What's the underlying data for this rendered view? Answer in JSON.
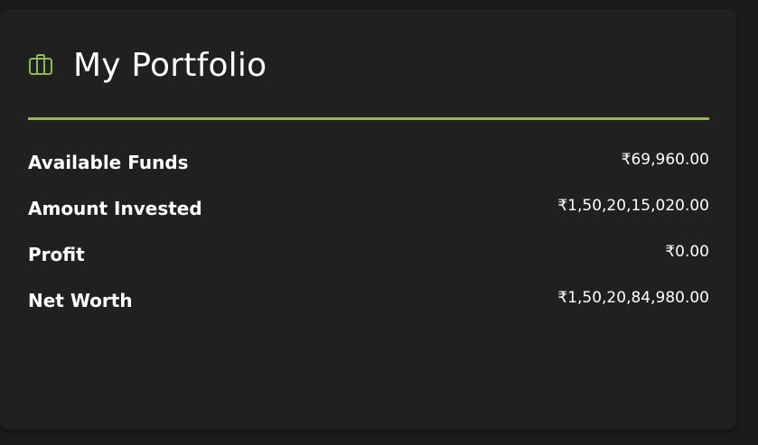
{
  "portfolio": {
    "icon": "briefcase-icon",
    "title": "My Portfolio",
    "accent_color": "#8db957",
    "rows": [
      {
        "label": "Available Funds",
        "value": "₹69,960.00"
      },
      {
        "label": "Amount Invested",
        "value": "₹1,50,20,15,020.00"
      },
      {
        "label": "Profit",
        "value": "₹0.00"
      },
      {
        "label": "Net Worth",
        "value": "₹1,50,20,84,980.00"
      }
    ]
  }
}
